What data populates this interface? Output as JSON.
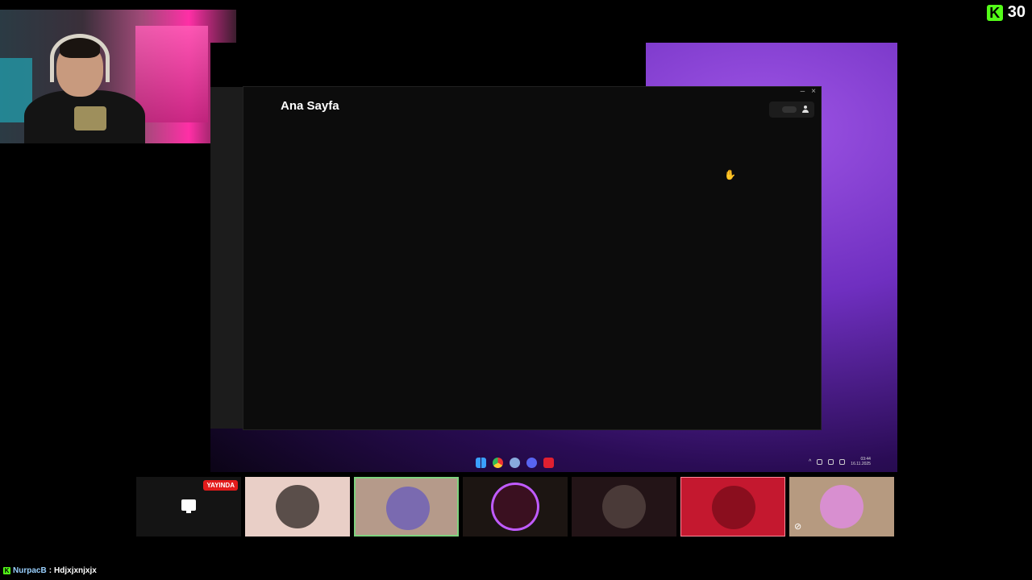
{
  "brand": {
    "viewer_count": "30",
    "accent": "#53fc18"
  },
  "app": {
    "page_title": "Ana Sayfa",
    "win_minimize": "–",
    "win_close": "×"
  },
  "taskbar": {
    "icons": [
      "windows-start-icon",
      "chrome-icon",
      "steam-icon",
      "discord-icon",
      "record-icon"
    ],
    "clock_time": "03:44",
    "clock_date": "16.11.2025"
  },
  "tiles": [
    {
      "name": "screen-share-tile",
      "badge": "YAYINDA",
      "bg": "#141414"
    },
    {
      "name": "participant-tile",
      "bg": "#e9cfc7",
      "avatar": "#5a4e4a"
    },
    {
      "name": "participant-tile-speaking",
      "bg": "#b59a8a",
      "avatar": "#7a6ab0",
      "border": "#7fd37f"
    },
    {
      "name": "participant-tile",
      "bg": "#1c1512",
      "avatar": "#3a1020",
      "ring": "#c05bff"
    },
    {
      "name": "participant-tile",
      "bg": "#231417",
      "avatar": "#4a3a38"
    },
    {
      "name": "participant-tile",
      "bg": "#c4182f",
      "avatar": "#8a0e1e"
    },
    {
      "name": "participant-tile-muted",
      "bg": "#b69a80",
      "avatar": "#d88fd0"
    }
  ],
  "chat": {
    "user": "NurpacB",
    "separator": ":",
    "message": "Hdjxjxnjxjx"
  }
}
